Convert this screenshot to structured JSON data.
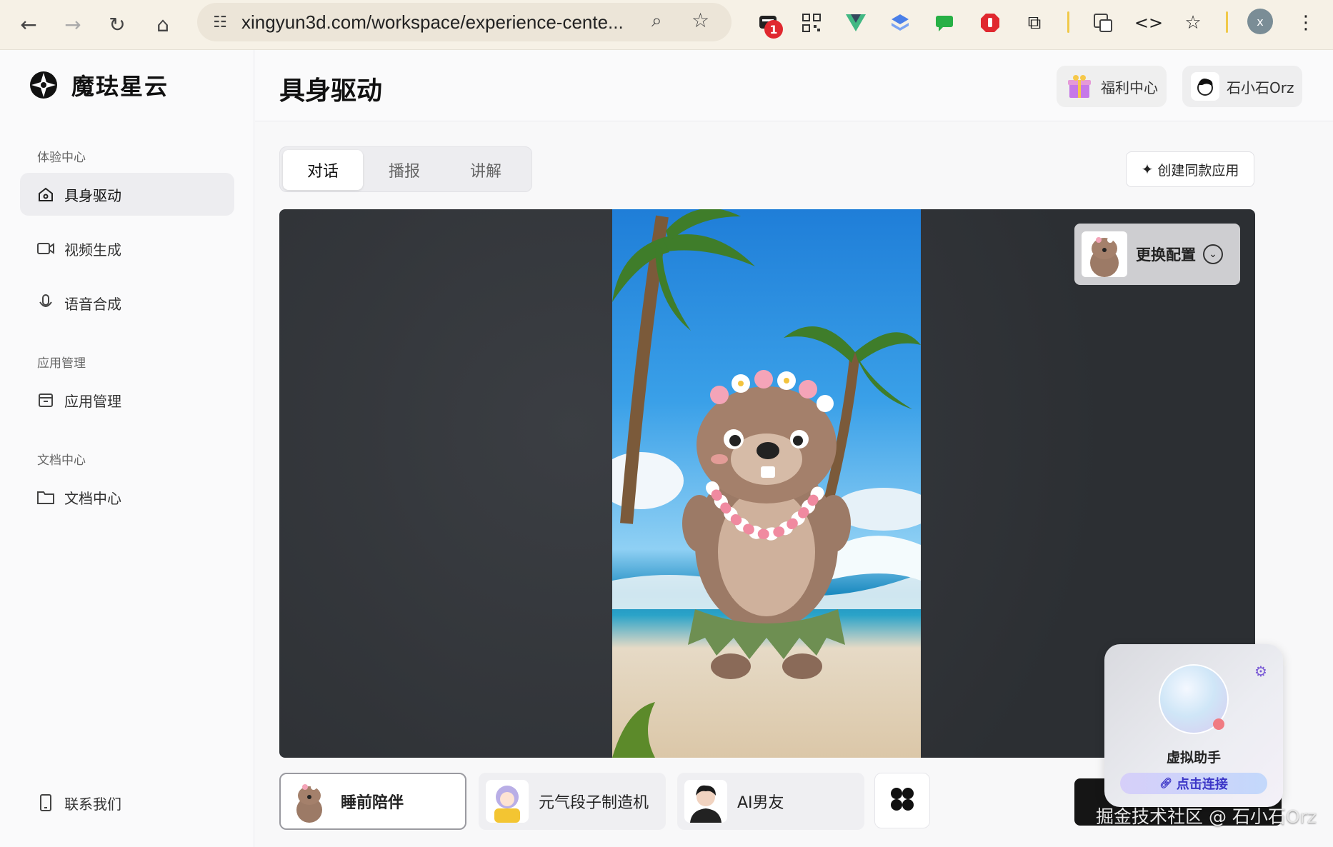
{
  "browser": {
    "url": "xingyun3d.com/workspace/experience-cente...",
    "ext_badge": "1",
    "profile_initial": "x"
  },
  "brand": {
    "name": "魔珐星云"
  },
  "sidebar": {
    "sections": [
      {
        "title": "体验中心",
        "items": [
          {
            "label": "具身驱动",
            "icon": "home-icon",
            "active": true
          },
          {
            "label": "视频生成",
            "icon": "video-icon"
          },
          {
            "label": "语音合成",
            "icon": "mic-icon"
          }
        ]
      },
      {
        "title": "应用管理",
        "items": [
          {
            "label": "应用管理",
            "icon": "box-icon"
          }
        ]
      },
      {
        "title": "文档中心",
        "items": [
          {
            "label": "文档中心",
            "icon": "folder-icon"
          }
        ]
      }
    ],
    "contact": "联系我们"
  },
  "header": {
    "title": "具身驱动",
    "welfare": "福利中心",
    "user": "石小石Orz"
  },
  "tabs": [
    "对话",
    "播报",
    "讲解"
  ],
  "active_tab": 0,
  "create_button": "创建同款应用",
  "config_button": "更换配置",
  "characters": [
    {
      "label": "睡前陪伴",
      "active": true
    },
    {
      "label": "元气段子制造机"
    },
    {
      "label": "AI男友"
    }
  ],
  "assistant": {
    "title": "虚拟助手",
    "link": "点击连接"
  },
  "watermark": "掘金技术社区 @ 石小石Orz",
  "colors": {
    "accent": "#3c37c7",
    "dark_stage": "#2c2f33"
  }
}
